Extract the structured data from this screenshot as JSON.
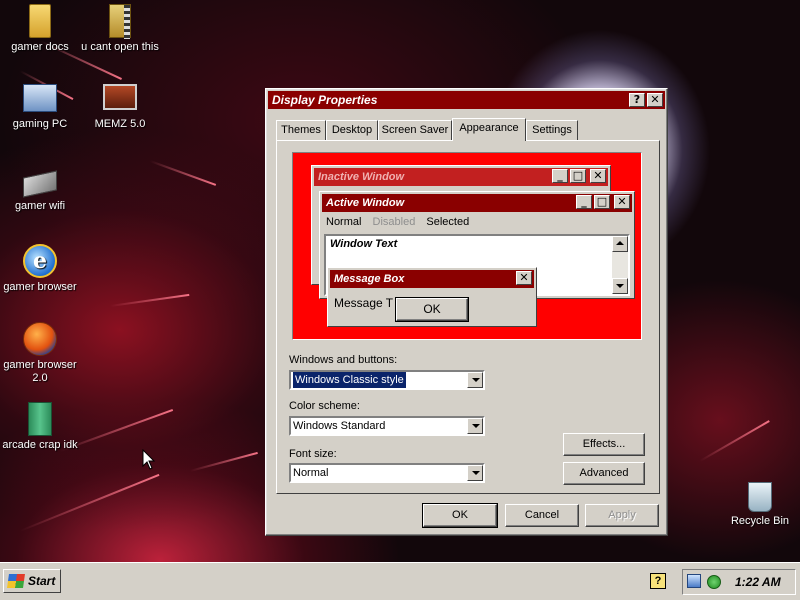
{
  "desktop": {
    "icons": [
      {
        "label": "gamer docs",
        "icon": "folder-icon"
      },
      {
        "label": "u cant open this",
        "icon": "zip-folder-icon"
      },
      {
        "label": "gaming PC",
        "icon": "computer-icon"
      },
      {
        "label": "MEMZ 5.0",
        "icon": "memz-app-icon"
      },
      {
        "label": "gamer wifi",
        "icon": "network-icon"
      },
      {
        "label": "gamer browser",
        "icon": "internet-explorer-icon"
      },
      {
        "label": "gamer browser 2.0",
        "icon": "firefox-icon"
      },
      {
        "label": "arcade crap idk",
        "icon": "green-book-icon"
      },
      {
        "label": "Recycle Bin",
        "icon": "recycle-bin-icon"
      }
    ]
  },
  "dialog": {
    "title": "Display Properties",
    "help_glyph": "?",
    "close_glyph": "✕",
    "tabs": [
      "Themes",
      "Desktop",
      "Screen Saver",
      "Appearance",
      "Settings"
    ],
    "active_tab": "Appearance",
    "preview": {
      "inactive_title": "Inactive Window",
      "active_title": "Active Window",
      "menu": {
        "normal": "Normal",
        "disabled": "Disabled",
        "selected": "Selected"
      },
      "window_text": "Window Text",
      "message_title": "Message Box",
      "message_text": "Message T",
      "ok_label": "OK",
      "min_glyph": "_",
      "max_glyph": "□",
      "close_glyph": "✕"
    },
    "windows_buttons_label": "Windows and buttons:",
    "windows_buttons_value": "Windows Classic style",
    "color_scheme_label": "Color scheme:",
    "color_scheme_value": "Windows Standard",
    "font_size_label": "Font size:",
    "font_size_value": "Normal",
    "effects_label": "Effects...",
    "advanced_label": "Advanced",
    "ok_label": "OK",
    "cancel_label": "Cancel",
    "apply_label": "Apply"
  },
  "taskbar": {
    "start_label": "Start",
    "help_glyph": "?",
    "clock": "1:22 AM"
  },
  "colors": {
    "title_active": "#8a0000",
    "preview_desktop": "#ff0000",
    "selection": "#0a246a",
    "face": "#d4d0c8"
  }
}
